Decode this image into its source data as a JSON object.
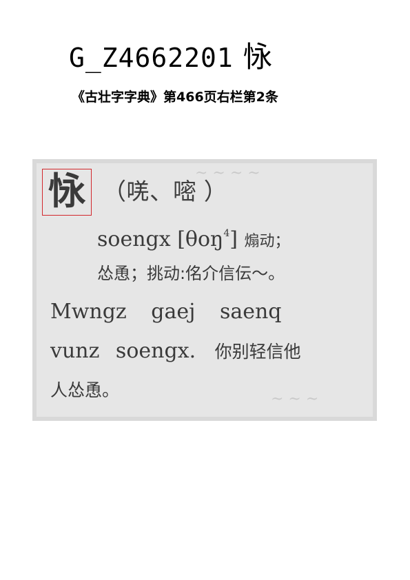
{
  "header": {
    "code": "G_Z4662201",
    "glyph": "怺"
  },
  "source": {
    "text": "《古壮字字典》第466页右栏第2条"
  },
  "entry": {
    "headword": "怺",
    "variants": "（唴、嘧 ）",
    "line1_romanization": "soengx",
    "line1_ipa": "[θoŋ",
    "line1_tone": "4",
    "line1_ipa_close": "]",
    "line1_gloss": "煽动；",
    "line2": "怂恿；挑动:佲介信伝～。",
    "line3": "Mwngz gaej saenq",
    "line4_latin": "vunz soengx.",
    "line4_cjk": "你别轻信他",
    "line5": "人怂恿。"
  }
}
